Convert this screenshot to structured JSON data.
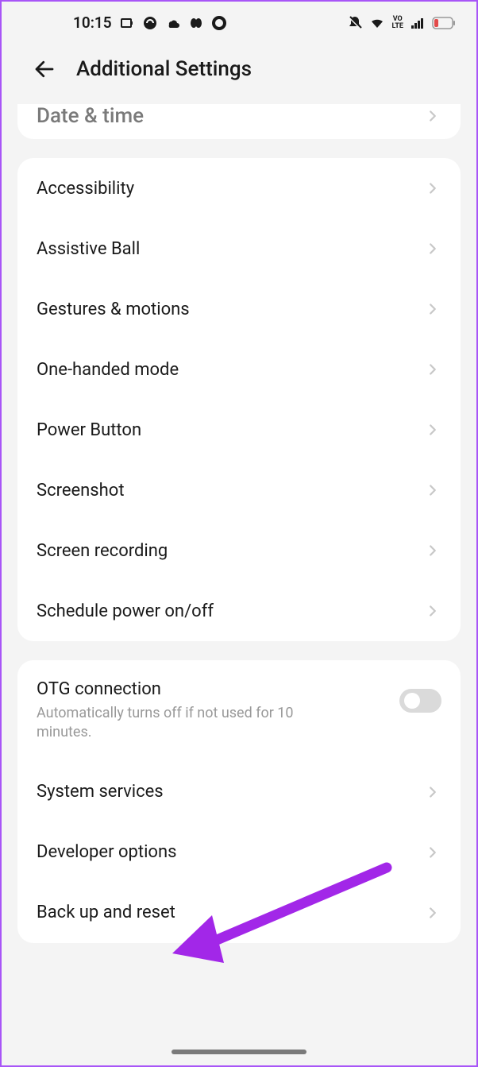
{
  "statusbar": {
    "time": "10:15",
    "icons": {
      "charging": "charging-icon",
      "circle": "circle-icon",
      "cloud": "cloud-icon",
      "pill": "pill-icon",
      "ring": "ring-icon"
    },
    "right": {
      "bell_off": "bell-off-icon",
      "wifi": "wifi-icon",
      "volte": "VO LTE",
      "signal": "signal-icon",
      "battery": "battery-low-icon"
    }
  },
  "header": {
    "title": "Additional Settings"
  },
  "card0": {
    "item0": "Date & time"
  },
  "card1": {
    "item0": "Accessibility",
    "item1": "Assistive Ball",
    "item2": "Gestures & motions",
    "item3": "One-handed mode",
    "item4": "Power Button",
    "item5": "Screenshot",
    "item6": "Screen recording",
    "item7": "Schedule power on/off"
  },
  "card2": {
    "item0": {
      "title": "OTG connection",
      "subtitle": "Automatically turns off if not used for 10 minutes."
    },
    "item1": "System services",
    "item2": "Developer options",
    "item3": "Back up and reset"
  },
  "annotation": {
    "arrow_color": "#a227e8"
  }
}
